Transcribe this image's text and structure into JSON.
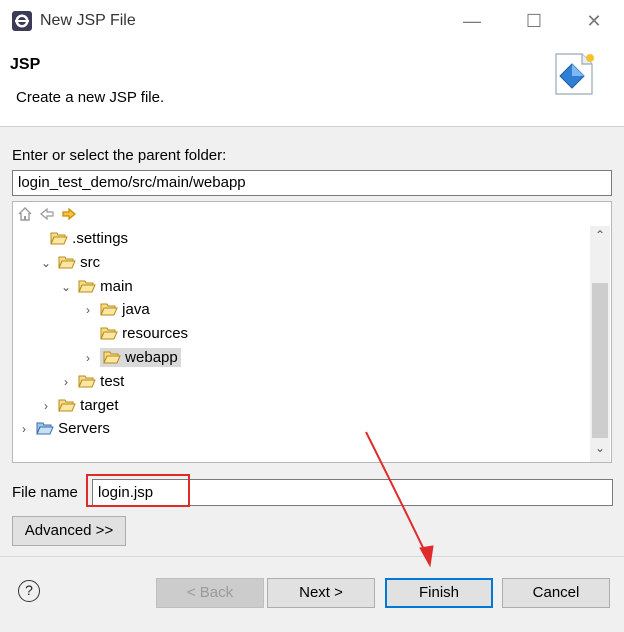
{
  "window": {
    "title": "New JSP File",
    "minimize": "—",
    "maximize": "☐",
    "close": "✕"
  },
  "header": {
    "title": "JSP",
    "description": "Create a new JSP file."
  },
  "parent_folder": {
    "label": "Enter or select the parent folder:",
    "value": "login_test_demo/src/main/webapp"
  },
  "tree": {
    "items": [
      {
        "label": ".settings",
        "chevron": ""
      },
      {
        "label": "src",
        "chevron": "⌄"
      },
      {
        "label": "main",
        "chevron": "⌄"
      },
      {
        "label": "java",
        "chevron": "›"
      },
      {
        "label": "resources",
        "chevron": ""
      },
      {
        "label": "webapp",
        "chevron": "›"
      },
      {
        "label": "test",
        "chevron": "›"
      },
      {
        "label": "target",
        "chevron": "›"
      },
      {
        "label": "Servers",
        "chevron": "›"
      }
    ],
    "scroll_up": "⌃",
    "scroll_down": "⌄"
  },
  "file_name": {
    "label": "File name",
    "value": "login.jsp"
  },
  "buttons": {
    "advanced": "Advanced >>",
    "help": "?",
    "back": "< Back",
    "next": "Next >",
    "finish": "Finish",
    "cancel": "Cancel"
  },
  "colors": {
    "annotation": "#e02b2b",
    "focus": "#0078d7",
    "folder": "#e8b84a"
  }
}
